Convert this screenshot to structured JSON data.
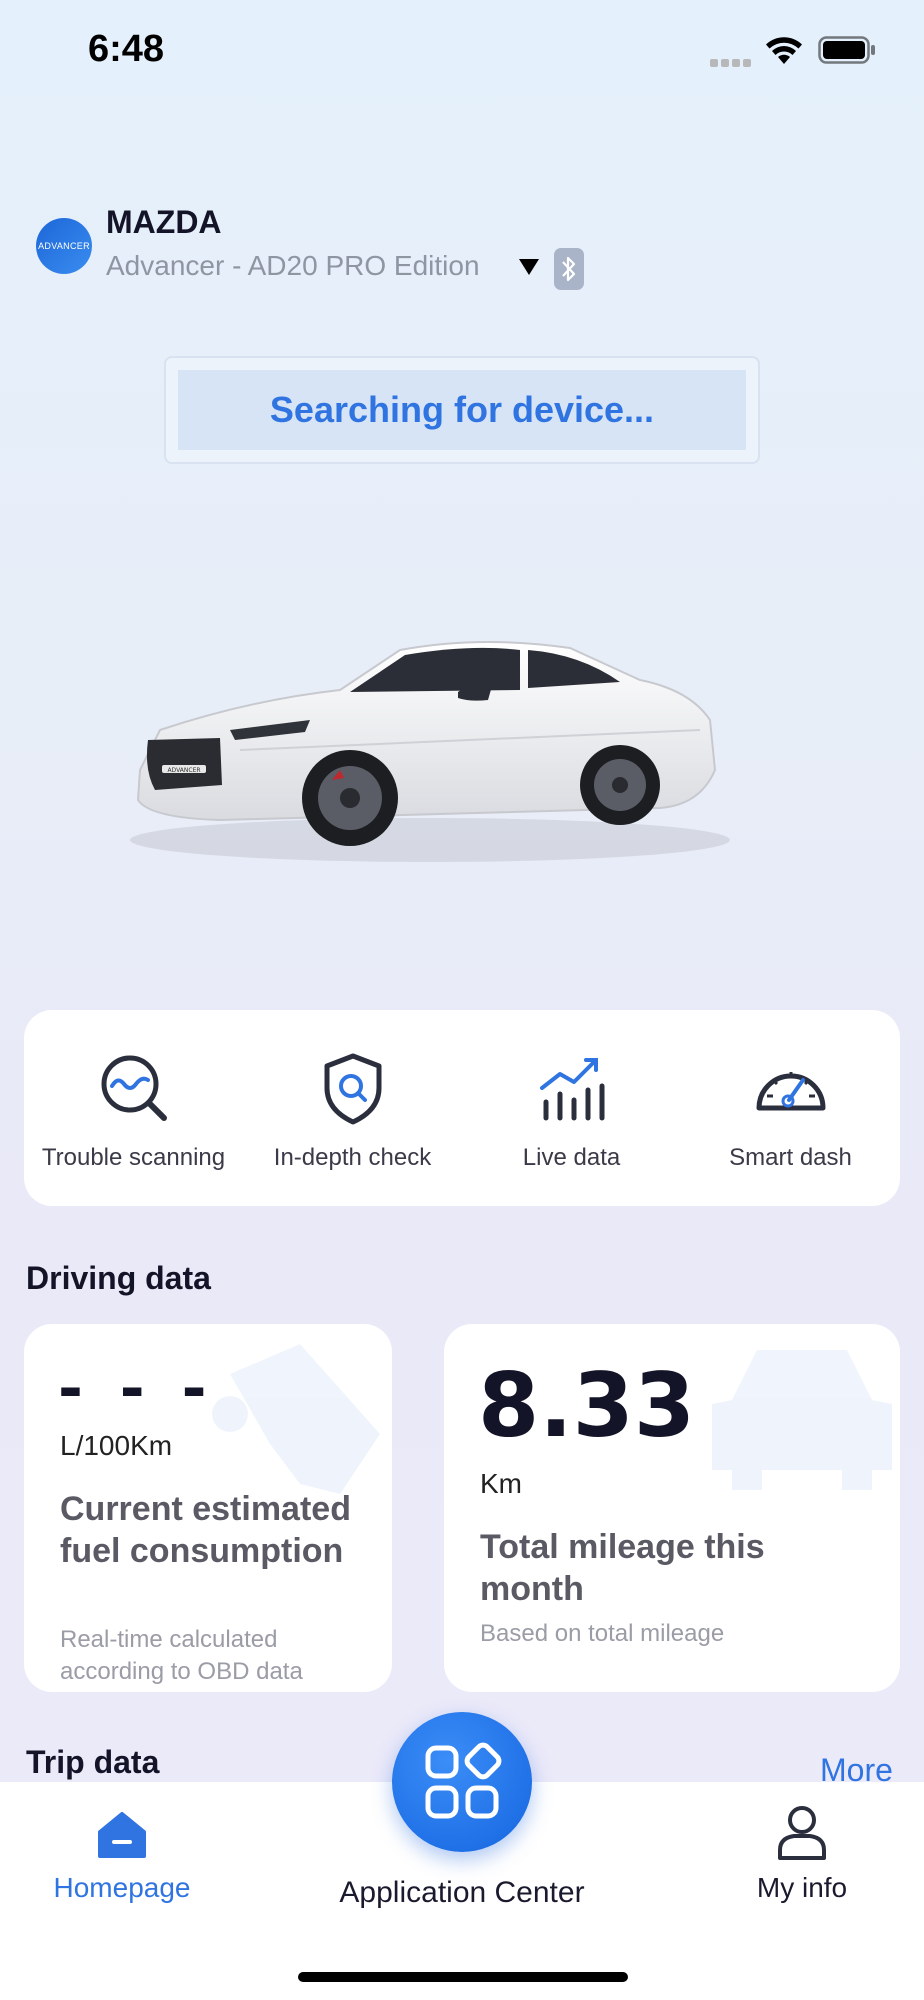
{
  "status_bar": {
    "time": "6:48"
  },
  "header": {
    "brand": "MAZDA",
    "logo_text": "ADVANCER",
    "device": "Advancer - AD20 PRO Edition"
  },
  "connection": {
    "status": "Searching for device..."
  },
  "car_badge": "ADVANCER",
  "quick_actions": [
    {
      "label": "Trouble scanning",
      "icon": "magnifier-pulse-icon"
    },
    {
      "label": "In-depth check",
      "icon": "shield-search-icon"
    },
    {
      "label": "Live data",
      "icon": "bar-chart-trend-icon"
    },
    {
      "label": "Smart dash",
      "icon": "speedometer-icon"
    }
  ],
  "driving_data": {
    "title": "Driving data",
    "fuel": {
      "value": "- - -",
      "unit": "L/100Km",
      "title": "Current estimated fuel consumption",
      "subtitle": "Real-time calculated according to OBD data"
    },
    "mileage": {
      "value": "8.33",
      "unit": "Km",
      "title": "Total mileage this month",
      "subtitle": "Based on total mileage"
    }
  },
  "trip_data": {
    "title": "Trip data",
    "more": "More"
  },
  "tab_bar": {
    "home": "Homepage",
    "center": "Application Center",
    "profile": "My info"
  },
  "colors": {
    "accent": "#2f74e0",
    "card": "#ffffff",
    "text": "#141428"
  }
}
